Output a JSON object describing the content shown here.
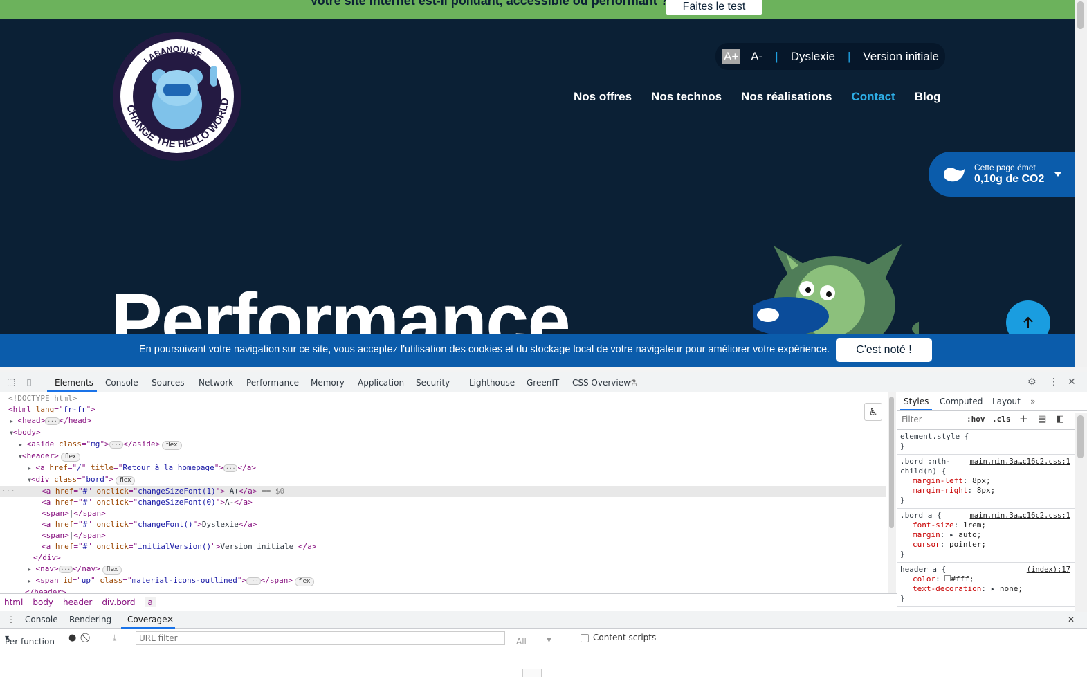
{
  "site": {
    "topbar": {
      "message": "Votre site internet est-il polluant, accessible ou performant ?",
      "button": "Faites le test"
    },
    "logo": {
      "top_text": "LABANQUI.SE",
      "bottom_text": "CHANGE THE HELLO WORLD"
    },
    "accessibility": {
      "a_plus": "A+",
      "a_minus": "A-",
      "sep": "|",
      "dyslexia": "Dyslexie",
      "initial": "Version initiale"
    },
    "nav": [
      "Nos offres",
      "Nos technos",
      "Nos réalisations",
      "Contact",
      "Blog"
    ],
    "co2": {
      "line1": "Cette page émet",
      "line2": "0,10g de CO2"
    },
    "headline": "Performance",
    "cookie": {
      "text": "En poursuivant votre navigation sur ce site, vous acceptez l'utilisation des cookies et du stockage local de votre navigateur pour améliorer votre expérience.",
      "button": "C'est noté !"
    },
    "colors": {
      "bg": "#0b2035",
      "topbar": "#6cb25c",
      "accent": "#2eaee6",
      "cookie": "#0b5cab"
    }
  },
  "devtools": {
    "tabs": [
      "Elements",
      "Console",
      "Sources",
      "Network",
      "Performance",
      "Memory",
      "Application",
      "Security",
      "Lighthouse",
      "GreenIT",
      "CSS Overview"
    ],
    "elements": {
      "doctype": "<!DOCTYPE html>",
      "html_lang": "fr-fr",
      "aside_class": "mg",
      "a_href": "/",
      "a_title": "Retour à la homepage",
      "div_class": "bord",
      "onclick1": "changeSizeFont(1)",
      "text1": "A+",
      "dollar": "== $0",
      "onclick2": "changeSizeFont(0)",
      "text2": "A-",
      "sep": "|",
      "onclick3": "changeFont()",
      "text3": "Dyslexie",
      "onclick4": "initialVersion()",
      "text4": "Version initiale ",
      "span_id": "up",
      "span_class": "material-icons-outlined",
      "flex": "flex",
      "hash": "#"
    },
    "breadcrumbs": [
      "html",
      "body",
      "header",
      "div.bord",
      "a"
    ],
    "styles": {
      "tabs": [
        "Styles",
        "Computed",
        "Layout"
      ],
      "filter_placeholder": "Filter",
      "hov": ":hov",
      "cls": ".cls",
      "element_style": "element.style {",
      "close": "}",
      "rule1": {
        "selector": ".bord :nth-child(n) {",
        "source": "main.min.3a…c16c2.css:1",
        "props": [
          [
            "margin-left",
            "8px;"
          ],
          [
            "margin-right",
            "8px;"
          ]
        ]
      },
      "rule2": {
        "selector": ".bord a {",
        "source": "main.min.3a…c16c2.css:1",
        "props": [
          [
            "font-size",
            "1rem;"
          ],
          [
            "margin",
            "auto;"
          ],
          [
            "cursor",
            "pointer;"
          ]
        ]
      },
      "rule3": {
        "selector": "header a {",
        "source": "(index):17",
        "props": [
          [
            "color",
            "#fff;"
          ],
          [
            "text-decoration",
            "none;"
          ]
        ]
      }
    },
    "drawer": {
      "tabs": [
        "Console",
        "Rendering",
        "Coverage"
      ],
      "per_function": "Per function",
      "url_filter": "URL filter",
      "all": "All",
      "content_scripts": "Content scripts"
    }
  }
}
